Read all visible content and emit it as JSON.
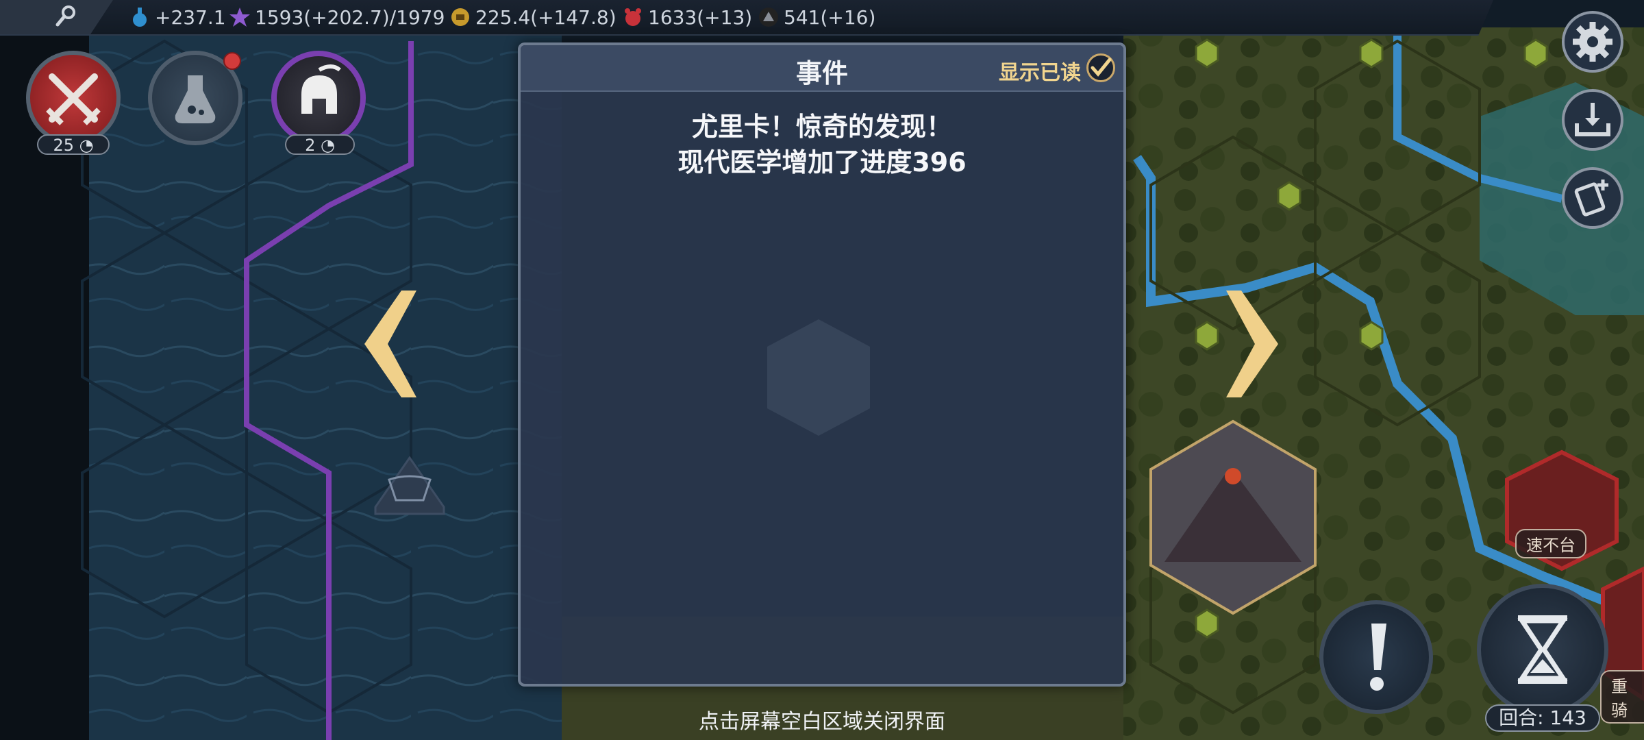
{
  "topbar": {
    "science": "+237.1",
    "culture": "1593(+202.7)/1979",
    "gold": "225.4(+147.8)",
    "faith": "1633(+13)",
    "military": "541(+16)"
  },
  "left_buttons": {
    "combat_counter": "25",
    "unit_counter": "2"
  },
  "modal": {
    "title": "事件",
    "show_read_label": "显示已读",
    "line1": "尤里卡！惊奇的发现！",
    "line2": "现代医学增加了进度396",
    "show_read_checked": true
  },
  "hint": "点击屏幕空白区域关闭界面",
  "turn": "回合: 143",
  "units": {
    "unit1": "速不台",
    "unit2": "重骑"
  },
  "colors": {
    "accent_gold": "#f1d58f",
    "border_purple": "#7a3fb0",
    "river_blue": "#3a8cc7",
    "combat_red": "#b02a2a"
  },
  "icons": [
    "search-icon",
    "science-icon",
    "culture-star-icon",
    "gold-icon",
    "faith-icon",
    "military-icon",
    "crossed-swords-icon",
    "flask-icon",
    "helmet-icon",
    "gear-icon",
    "download-icon",
    "add-card-icon",
    "check-icon",
    "left-arrow-icon",
    "right-arrow-icon",
    "exclamation-icon",
    "hourglass-icon"
  ]
}
